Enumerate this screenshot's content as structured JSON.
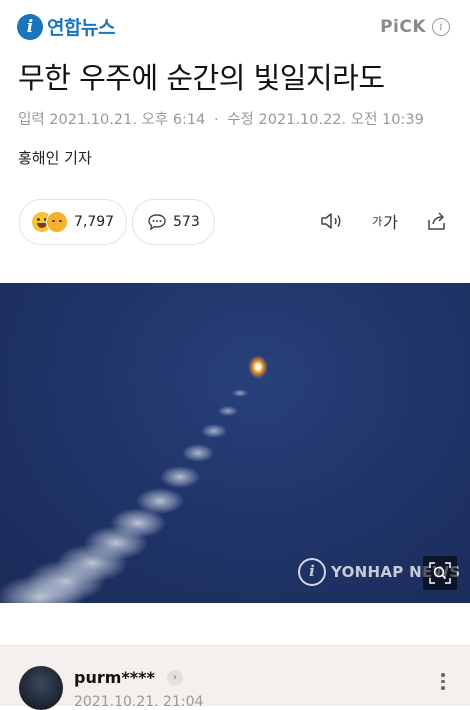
{
  "header": {
    "brand_badge": "i",
    "brand_name": "연합뉴스",
    "pick_label": "PiCK",
    "info_symbol": "i"
  },
  "article": {
    "headline": "무한 우주에 순간의 빛일지라도",
    "input_label": "입력",
    "input_date": "2021.10.21. 오후 6:14",
    "modified_label": "수정",
    "modified_date": "2021.10.22. 오전 10:39",
    "reporter": "홍해인 기자"
  },
  "engagement": {
    "reaction_count": "7,797",
    "comment_count": "573",
    "font_size_small": "가",
    "font_size_large": "가"
  },
  "photo": {
    "watermark_badge": "i",
    "watermark_text": "YONHAP NEWS"
  },
  "comment": {
    "username": "purm****",
    "arrow": "›",
    "timestamp": "2021.10.21. 21:04"
  },
  "colors": {
    "brand": "#1b75bc",
    "sky": "#20356a"
  },
  "icons": {
    "speaker": "speaker-icon",
    "share": "share-icon",
    "comment": "speech-bubble-icon",
    "zoom": "zoom-icon",
    "more": "more-vertical-icon"
  }
}
